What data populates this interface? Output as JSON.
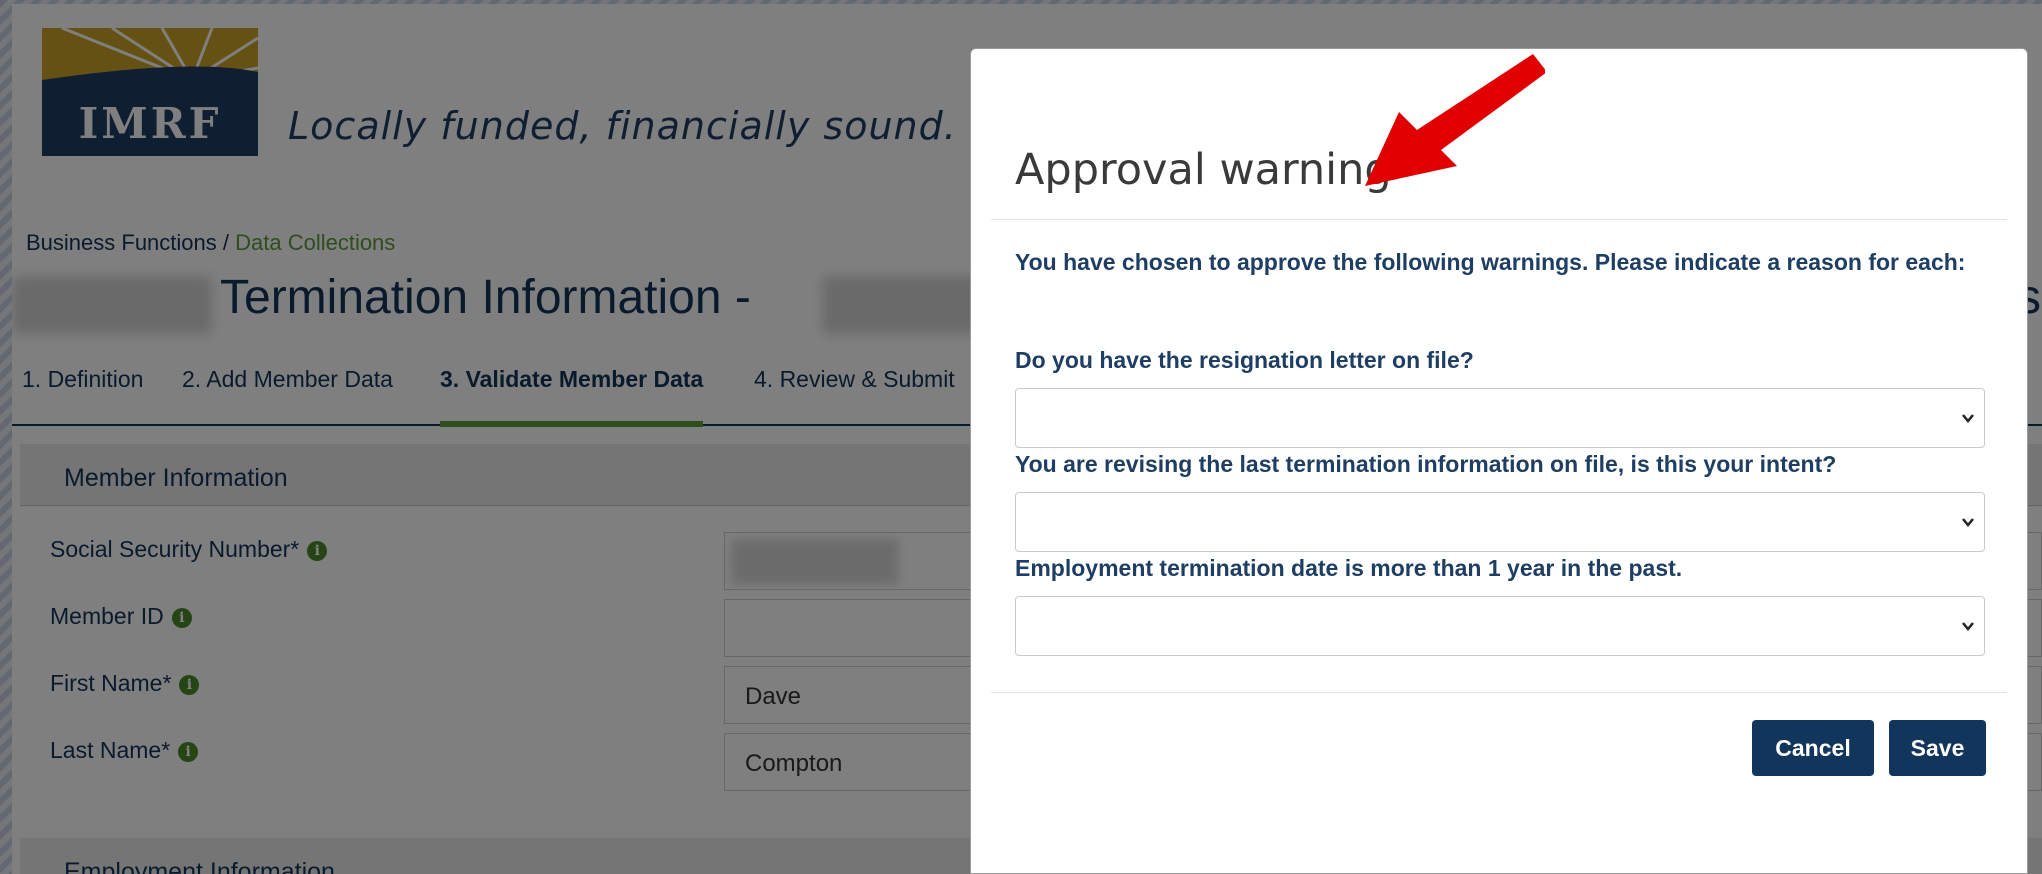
{
  "header": {
    "logo_text": "IMRF",
    "tagline": "Locally funded, financially sound."
  },
  "breadcrumb": {
    "parent": "Business Functions /",
    "current": "Data Collections"
  },
  "page": {
    "title": "Termination Information -",
    "right_edge_text": "si"
  },
  "steps": [
    {
      "label": "1. Definition"
    },
    {
      "label": "2. Add Member Data"
    },
    {
      "label": "3. Validate Member Data"
    },
    {
      "label": "4. Review & Submit"
    }
  ],
  "member_section": {
    "title": "Member Information",
    "fields": [
      {
        "label": "Social Security Number*",
        "value": ""
      },
      {
        "label": "Member ID",
        "value": ""
      },
      {
        "label": "First Name*",
        "value": "Dave"
      },
      {
        "label": "Last Name*",
        "value": "Compton"
      }
    ]
  },
  "employment_section": {
    "title": "Employment Information"
  },
  "modal": {
    "title": "Approval warning",
    "intro": "You have chosen to approve the following warnings. Please indicate a reason for each:",
    "questions": [
      {
        "label": "Do you have the resignation letter on file?",
        "selected": ""
      },
      {
        "label": "You are revising the last termination information on file, is this your intent?",
        "selected": ""
      },
      {
        "label": "Employment termination date is more than 1 year in the past.",
        "selected": ""
      }
    ],
    "cancel_label": "Cancel",
    "save_label": "Save"
  },
  "colors": {
    "navy": "#12355b",
    "green": "#5f9a3a",
    "gold": "#c9a227",
    "arrow_red": "#e00000"
  }
}
